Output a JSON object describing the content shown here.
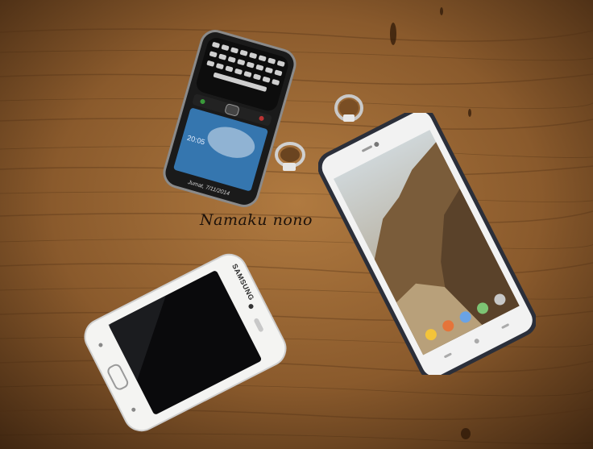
{
  "photo": {
    "caption": "Namaku nono",
    "samsung_brand": "SAMSUNG",
    "blackberry_clock": "20:05",
    "blackberry_label": "Jumat, 7/11/2014"
  },
  "colors": {
    "wood_base": "#8a5a2c",
    "wood_dark": "#4d2f14",
    "samsung_body": "#f4f4f2",
    "android_frame": "#2b2f3a"
  }
}
